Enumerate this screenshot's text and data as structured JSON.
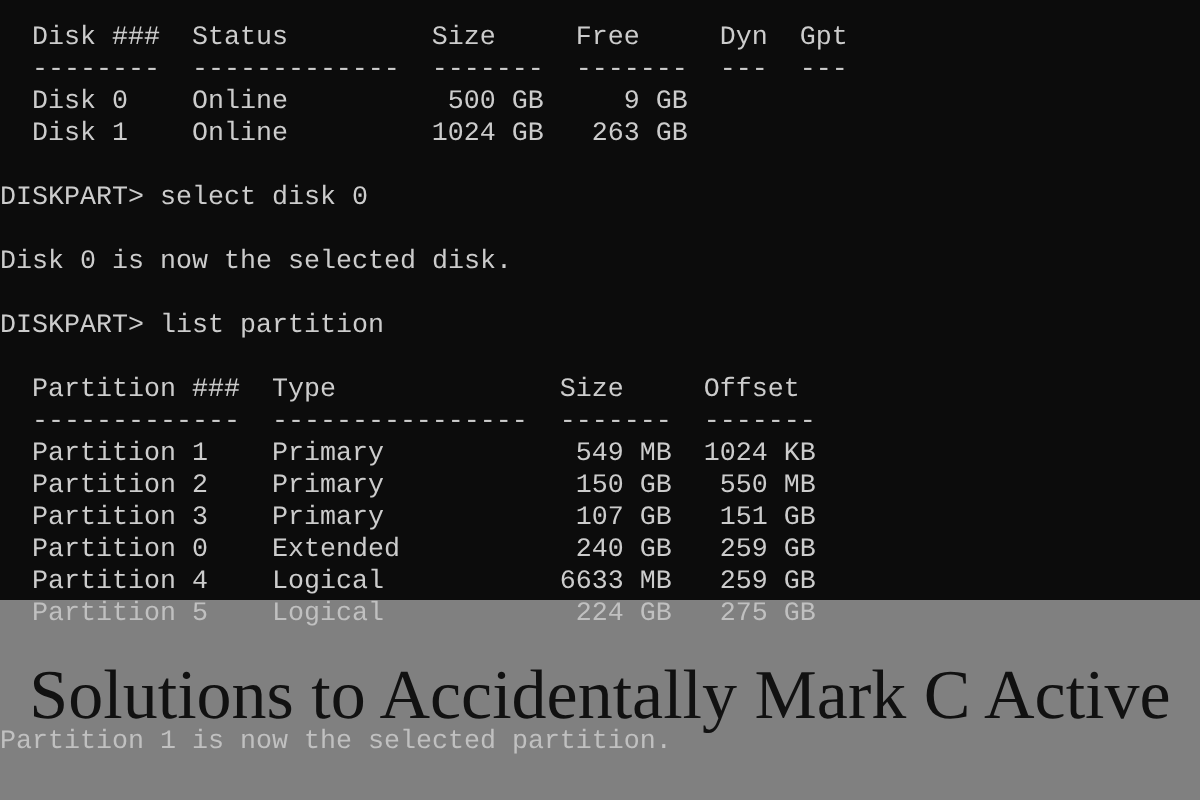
{
  "disk_table": {
    "columns": [
      "Disk ###",
      "Status",
      "Size",
      "Free",
      "Dyn",
      "Gpt"
    ],
    "separators": [
      "--------",
      "-------------",
      "-------",
      "-------",
      "---",
      "---"
    ],
    "rows": [
      [
        "Disk 0",
        "Online",
        "500 GB",
        "9 GB",
        "",
        ""
      ],
      [
        "Disk 1",
        "Online",
        "1024 GB",
        "263 GB",
        "",
        ""
      ]
    ]
  },
  "lines_1": [
    "DISKPART> select disk 0",
    "Disk 0 is now the selected disk.",
    "DISKPART> list partition"
  ],
  "partition_table": {
    "columns": [
      "Partition ###",
      "Type",
      "Size",
      "Offset"
    ],
    "separators": [
      "-------------",
      "----------------",
      "-------",
      "-------"
    ],
    "rows": [
      [
        "Partition 1",
        "Primary",
        "549 MB",
        "1024 KB"
      ],
      [
        "Partition 2",
        "Primary",
        "150 GB",
        "550 MB"
      ],
      [
        "Partition 3",
        "Primary",
        "107 GB",
        "151 GB"
      ],
      [
        "Partition 0",
        "Extended",
        "240 GB",
        "259 GB"
      ],
      [
        "Partition 4",
        "Logical",
        "6633 MB",
        "259 GB"
      ],
      [
        "Partition 5",
        "Logical",
        "224 GB",
        "275 GB"
      ]
    ]
  },
  "lines_2": [
    "Partition 1 is now the selected partition."
  ],
  "banner": {
    "title": "Solutions to Accidentally Mark C Active"
  }
}
